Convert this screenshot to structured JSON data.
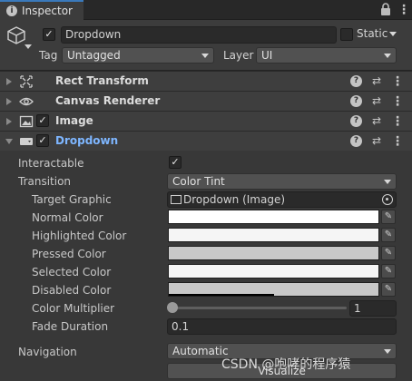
{
  "window": {
    "tab_label": "Inspector",
    "lock_icon": "lock-icon",
    "menu_icon": "kebab-menu-icon"
  },
  "gameobject": {
    "active": true,
    "name": "Dropdown",
    "static_label": "Static",
    "static_checked": false,
    "tag_label": "Tag",
    "tag_value": "Untagged",
    "layer_label": "Layer",
    "layer_value": "UI"
  },
  "components": [
    {
      "name": "Rect Transform",
      "icon": "rect-transform-icon",
      "has_checkbox": false,
      "expanded": false
    },
    {
      "name": "Canvas Renderer",
      "icon": "eye-icon",
      "has_checkbox": false,
      "expanded": false
    },
    {
      "name": "Image",
      "icon": "image-icon",
      "has_checkbox": true,
      "expanded": false
    },
    {
      "name": "Dropdown",
      "icon": "dropdown-icon",
      "has_checkbox": true,
      "expanded": true
    }
  ],
  "dropdown_props": {
    "interactable_label": "Interactable",
    "interactable_checked": true,
    "transition_label": "Transition",
    "transition_value": "Color Tint",
    "target_graphic_label": "Target Graphic",
    "target_graphic_value": "Dropdown (Image)",
    "normal_color_label": "Normal Color",
    "normal_color": "#ffffff",
    "highlighted_color_label": "Highlighted Color",
    "highlighted_color": "#f5f5f5",
    "pressed_color_label": "Pressed Color",
    "pressed_color": "#c8c8c8",
    "selected_color_label": "Selected Color",
    "selected_color": "#f5f5f5",
    "disabled_color_label": "Disabled Color",
    "disabled_color": "#c8c8c8",
    "color_multiplier_label": "Color Multiplier",
    "color_multiplier_value": "1",
    "fade_duration_label": "Fade Duration",
    "fade_duration_value": "0.1",
    "navigation_label": "Navigation",
    "navigation_value": "Automatic",
    "visualize_label": "Visualize"
  },
  "watermark": "CSDN @咆哮的程序猿"
}
